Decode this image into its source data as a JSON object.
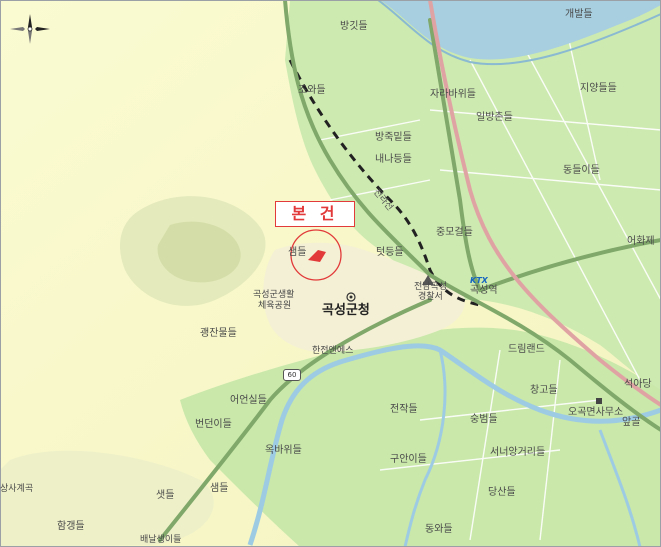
{
  "map": {
    "callout_label": "본 건",
    "city_hall_label": "곡성군청",
    "route_number": "60",
    "ktx_badge": "KTX",
    "labels": [
      {
        "id": "lbl-1",
        "text": "방깃들"
      },
      {
        "id": "lbl-2",
        "text": "개발들"
      },
      {
        "id": "lbl-3",
        "text": "조와들"
      },
      {
        "id": "lbl-4",
        "text": "자라바위들"
      },
      {
        "id": "lbl-5",
        "text": "지양들들"
      },
      {
        "id": "lbl-6",
        "text": "일방촌들"
      },
      {
        "id": "lbl-7",
        "text": "방죽밑들"
      },
      {
        "id": "lbl-8",
        "text": "내나등들"
      },
      {
        "id": "lbl-9",
        "text": "동들이들"
      },
      {
        "id": "lbl-10",
        "text": "중모걸들"
      },
      {
        "id": "lbl-11",
        "text": "어화제"
      },
      {
        "id": "lbl-12",
        "text": "샘들"
      },
      {
        "id": "lbl-13",
        "text": "텃등들"
      },
      {
        "id": "lbl-14",
        "text": "곡성역"
      },
      {
        "id": "lbl-15",
        "text": "곡성군생활"
      },
      {
        "id": "lbl-16",
        "text": "체육공원"
      },
      {
        "id": "lbl-17",
        "text": "전남곡성"
      },
      {
        "id": "lbl-18",
        "text": "경찰서"
      },
      {
        "id": "lbl-19",
        "text": "괭잔물들"
      },
      {
        "id": "lbl-20",
        "text": "한전앤에스"
      },
      {
        "id": "lbl-21",
        "text": "드림랜드"
      },
      {
        "id": "lbl-22",
        "text": "석아당"
      },
      {
        "id": "lbl-23",
        "text": "어언실들"
      },
      {
        "id": "lbl-24",
        "text": "창고들"
      },
      {
        "id": "lbl-25",
        "text": "번던이들"
      },
      {
        "id": "lbl-26",
        "text": "전작들"
      },
      {
        "id": "lbl-27",
        "text": "숭범들"
      },
      {
        "id": "lbl-28",
        "text": "오곡면사무소"
      },
      {
        "id": "lbl-29",
        "text": "앞골"
      },
      {
        "id": "lbl-30",
        "text": "옥바위들"
      },
      {
        "id": "lbl-31",
        "text": "구안이들"
      },
      {
        "id": "lbl-32",
        "text": "서너앙거리들"
      },
      {
        "id": "lbl-33",
        "text": "상사계곡"
      },
      {
        "id": "lbl-34",
        "text": "샘들"
      },
      {
        "id": "lbl-35",
        "text": "샛들"
      },
      {
        "id": "lbl-36",
        "text": "당산들"
      },
      {
        "id": "lbl-37",
        "text": "함갱들"
      },
      {
        "id": "lbl-38",
        "text": "배날생이들"
      },
      {
        "id": "lbl-39",
        "text": "동와들"
      },
      {
        "id": "lbl-40",
        "text": "전라선"
      }
    ]
  }
}
